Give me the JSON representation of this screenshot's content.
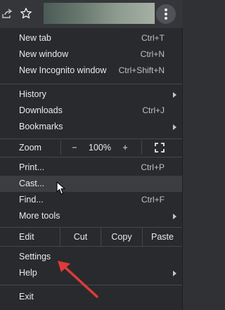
{
  "colors": {
    "menu_bg": "#292a2d",
    "hover_bg": "#3c3d40",
    "text": "#e8eaed",
    "shortcut_text": "#bdc1c6",
    "annotation_arrow": "#e03a3a"
  },
  "toolbar": {
    "share_icon": "share-icon",
    "star_icon": "star-icon",
    "menu_icon": "three-dot-menu-icon"
  },
  "menu": {
    "new_tab": {
      "label": "New tab",
      "shortcut": "Ctrl+T"
    },
    "new_window": {
      "label": "New window",
      "shortcut": "Ctrl+N"
    },
    "new_incognito": {
      "label": "New Incognito window",
      "shortcut": "Ctrl+Shift+N"
    },
    "history": {
      "label": "History"
    },
    "downloads": {
      "label": "Downloads",
      "shortcut": "Ctrl+J"
    },
    "bookmarks": {
      "label": "Bookmarks"
    },
    "zoom": {
      "label": "Zoom",
      "minus": "−",
      "level": "100%",
      "plus": "+"
    },
    "print": {
      "label": "Print...",
      "shortcut": "Ctrl+P"
    },
    "cast": {
      "label": "Cast..."
    },
    "find": {
      "label": "Find...",
      "shortcut": "Ctrl+F"
    },
    "more_tools": {
      "label": "More tools"
    },
    "edit": {
      "label": "Edit",
      "cut": "Cut",
      "copy": "Copy",
      "paste": "Paste"
    },
    "settings": {
      "label": "Settings"
    },
    "help": {
      "label": "Help"
    },
    "exit": {
      "label": "Exit"
    }
  }
}
